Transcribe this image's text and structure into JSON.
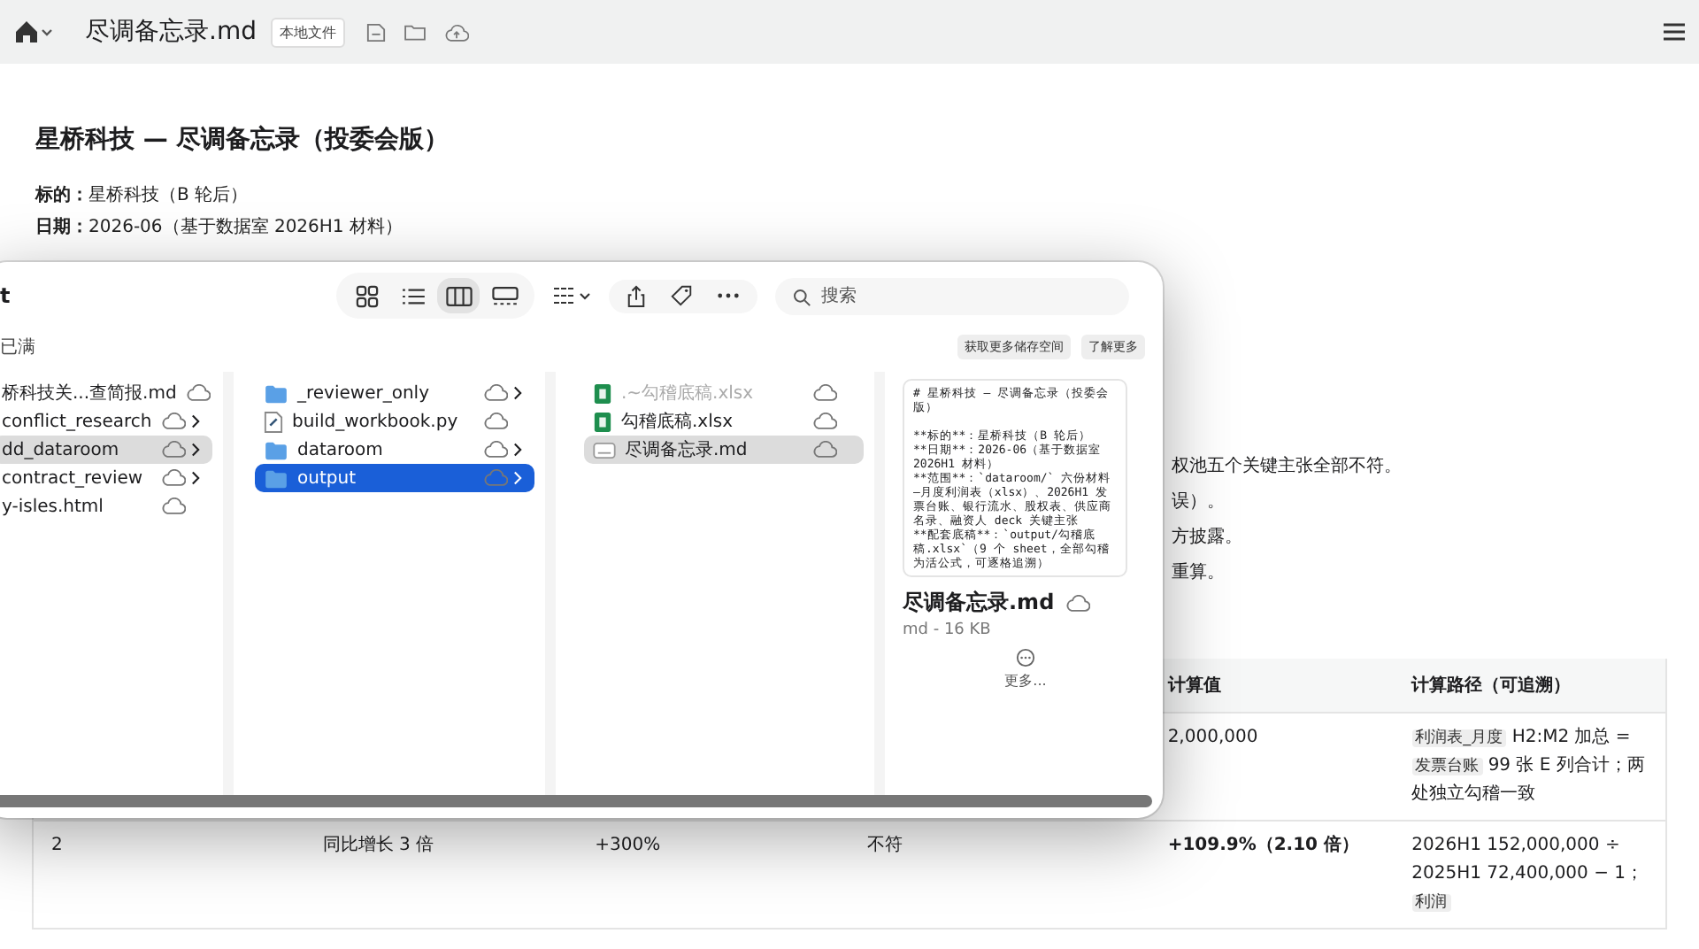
{
  "topbar": {
    "title": "尽调备忘录.md",
    "badge": "本地文件"
  },
  "document": {
    "title": "星桥科技 — 尽调备忘录（投委会版）",
    "meta": [
      {
        "label": "标的：",
        "value": "星桥科技（B 轮后）"
      },
      {
        "label": "日期：",
        "value": "2026-06（基于数据室 2026H1 材料）"
      }
    ],
    "fragments": [
      "权池五个关键主张全部不符。",
      "误）。",
      "方披露。",
      "重算。"
    ]
  },
  "table": {
    "columns": [
      "",
      "",
      "",
      "",
      "计算值",
      "计算路径（可追溯）"
    ],
    "rows": [
      {
        "cells": [
          "",
          "",
          "",
          "",
          "2,000,000"
        ],
        "bold": false,
        "path": [
          {
            "kind": "code",
            "text": "利润表_月度"
          },
          {
            "kind": "text",
            "text": " H2:M2 加总 = "
          },
          {
            "kind": "code",
            "text": "发票台账"
          },
          {
            "kind": "text",
            "text": " 99 张 E 列合计；两处独立勾稽一致"
          }
        ]
      },
      {
        "cells": [
          "2",
          "同比增长 3 倍",
          "+300%",
          "不符",
          "+109.9%（2.10 倍）"
        ],
        "bold": true,
        "path": [
          {
            "kind": "text",
            "text": "2026H1 152,000,000 ÷ 2025H1 72,400,000 − 1；"
          },
          {
            "kind": "code",
            "text": "利润"
          }
        ]
      }
    ]
  },
  "finder": {
    "title": "t",
    "views": [
      {
        "kind": "icons",
        "selected": false
      },
      {
        "kind": "list",
        "selected": false
      },
      {
        "kind": "columns",
        "selected": true
      },
      {
        "kind": "gallery",
        "selected": false
      }
    ],
    "search": {
      "placeholder": "搜索"
    },
    "notice": {
      "text": "已满",
      "buttons": [
        "获取更多储存空间",
        "了解更多"
      ]
    },
    "columns": [
      {
        "items": [
          {
            "name": "桥科技关...查简报.md",
            "kind": "md",
            "selected": false,
            "dimmed": false
          },
          {
            "name": "conflict_research",
            "kind": "folder",
            "selected": false,
            "dimmed": false
          },
          {
            "name": "dd_dataroom",
            "kind": "folder",
            "selected": true,
            "dimmed": false
          },
          {
            "name": "contract_review",
            "kind": "folder",
            "selected": false,
            "dimmed": false
          },
          {
            "name": "y-isles.html",
            "kind": "html",
            "selected": false,
            "dimmed": false
          }
        ]
      },
      {
        "items": [
          {
            "name": "_reviewer_only",
            "kind": "folder",
            "selected": false,
            "dimmed": false
          },
          {
            "name": "build_workbook.py",
            "kind": "py",
            "selected": false,
            "dimmed": false
          },
          {
            "name": "dataroom",
            "kind": "folder",
            "selected": false,
            "dimmed": false
          },
          {
            "name": "output",
            "kind": "folder",
            "selected": true,
            "dimmed": false
          }
        ]
      },
      {
        "items": [
          {
            "name": ".~勾稽底稿.xlsx",
            "kind": "xlsx",
            "selected": false,
            "dimmed": true
          },
          {
            "name": "勾稽底稿.xlsx",
            "kind": "xlsx",
            "selected": false,
            "dimmed": false
          },
          {
            "name": "尽调备忘录.md",
            "kind": "md",
            "selected": true,
            "dimmed": false
          }
        ]
      }
    ],
    "preview": {
      "text": "# 星桥科技 — 尽调备忘录（投委会版）\n\n**标的**：星桥科技（B 轮后）\n**日期**：2026-06（基于数据室 2026H1 材料）\n**范围**：`dataroom/` 六份材料—月度利润表（xlsx）、2026H1 发票台账、银行流水、股权表、供应商名录、融资人 deck 关键主张\n**配套底稿**：`output/勾稽底稿.xlsx`（9 个 sheet，全部勾稽为活公式，可逐格追溯）",
      "name": "尽调备忘录.md",
      "info": "md - 16 KB",
      "more": "更多..."
    }
  }
}
